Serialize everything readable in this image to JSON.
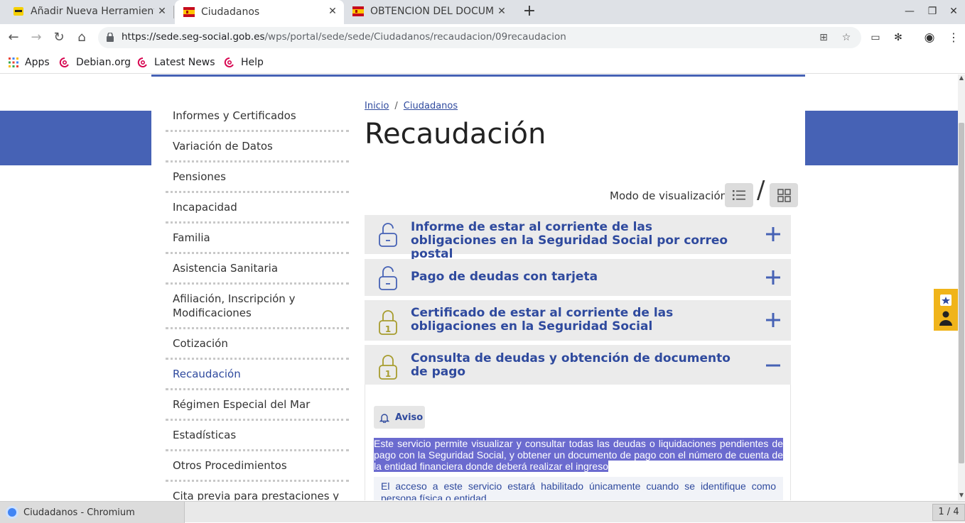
{
  "browser": {
    "tabs": [
      {
        "title": "Añadir Nueva Herramienta",
        "active": false
      },
      {
        "title": "Ciudadanos",
        "active": true
      },
      {
        "title": "OBTENCIÓN DEL DOCUM",
        "active": false
      }
    ],
    "url_host": "https://sede.seg-social.gob.es",
    "url_path": "/wps/portal/sede/sede/Ciudadanos/recaudacion/09recaudacion",
    "bookmarks": [
      {
        "label": "Apps"
      },
      {
        "label": "Debian.org"
      },
      {
        "label": "Latest News"
      },
      {
        "label": "Help"
      }
    ]
  },
  "page": {
    "sidebar": {
      "items": [
        {
          "label": "Informes y Certificados",
          "current": false
        },
        {
          "label": "Variación de Datos",
          "current": false
        },
        {
          "label": "Pensiones",
          "current": false
        },
        {
          "label": "Incapacidad",
          "current": false
        },
        {
          "label": "Familia",
          "current": false
        },
        {
          "label": "Asistencia Sanitaria",
          "current": false
        },
        {
          "label": "Afiliación, Inscripción y Modificaciones",
          "current": false
        },
        {
          "label": "Cotización",
          "current": false
        },
        {
          "label": "Recaudación",
          "current": true
        },
        {
          "label": "Régimen Especial del Mar",
          "current": false
        },
        {
          "label": "Estadísticas",
          "current": false
        },
        {
          "label": "Otros Procedimientos",
          "current": false
        },
        {
          "label": "Cita previa para prestaciones y otras gestiones",
          "current": false
        }
      ]
    },
    "breadcrumb": {
      "home": "Inicio",
      "separator": "/",
      "current": "Ciudadanos"
    },
    "title": "Recaudación",
    "view_mode_label": "Modo de visualización:",
    "view_mode_separator": "/",
    "accordion": [
      {
        "title": "Informe de estar al corriente de las obligaciones en la Seguridad Social por correo postal",
        "icon": "unlocked-icon",
        "expanded": false
      },
      {
        "title": "Pago de deudas con tarjeta",
        "icon": "unlocked-icon",
        "expanded": false
      },
      {
        "title": "Certificado de estar al corriente de las obligaciones en la Seguridad Social",
        "icon": "lock-level-1-icon",
        "expanded": false
      },
      {
        "title": "Consulta de deudas y obtención de documento de pago",
        "icon": "lock-level-1-icon",
        "expanded": true
      }
    ],
    "aviso_label": "Aviso",
    "description": "Este servicio permite visualizar y consultar todas las deudas o liquidaciones pendientes de pago con la Seguridad Social, y obtener un documento de pago con el número de cuenta de la entidad financiera donde deberá realizar el ingreso",
    "note": "El acceso a este servicio estará habilitado únicamente cuando se identifique como persona física o entidad."
  },
  "taskbar": {
    "window_title": "Ciudadanos - Chromium",
    "pager": "1 / 4"
  },
  "colors": {
    "brand_blue": "#4662b5",
    "link_blue": "#2f4a9e",
    "lock_olive": "#a79c2e",
    "widget_yellow": "#f0b41a",
    "selection": "#6b6bcf"
  }
}
